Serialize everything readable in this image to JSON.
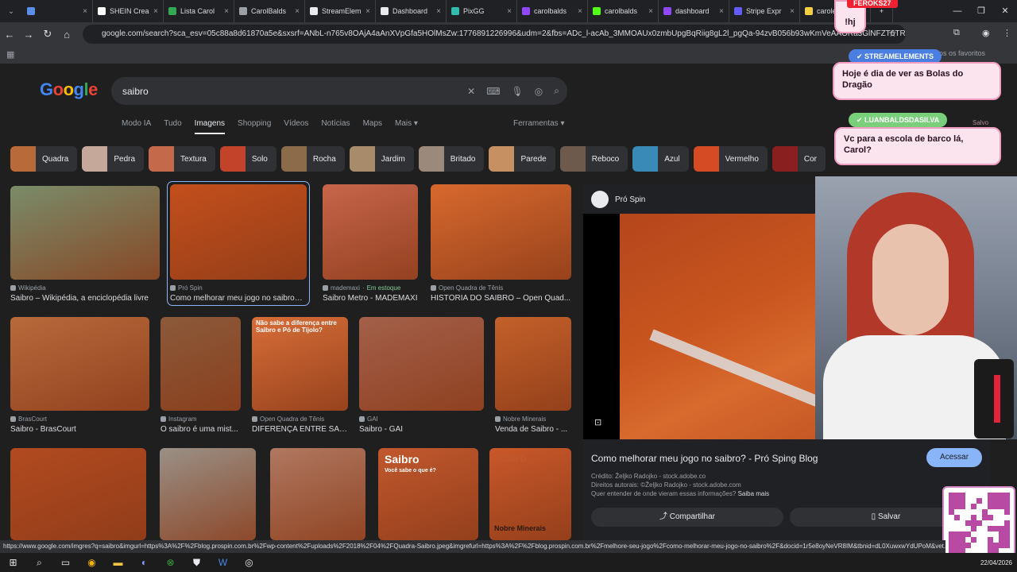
{
  "browser": {
    "tabs": [
      {
        "label": "",
        "color": "#5a8ee8"
      },
      {
        "label": "SHEIN Crea",
        "color": "#ffffff"
      },
      {
        "label": "Lista Carol",
        "color": "#34a853"
      },
      {
        "label": "CarolBalds",
        "color": "#9aa0a6"
      },
      {
        "label": "StreamElem",
        "color": "#e8eaed"
      },
      {
        "label": "Dashboard",
        "color": "#e8eaed"
      },
      {
        "label": "PixGG",
        "color": "#32bcad"
      },
      {
        "label": "carolbalds",
        "color": "#9146ff"
      },
      {
        "label": "carolbalds",
        "color": "#53fc18"
      },
      {
        "label": "dashboard",
        "color": "#9146ff"
      },
      {
        "label": "Stripe Expr",
        "color": "#635bff"
      },
      {
        "label": "carolerhay",
        "color": "#f4d03f"
      }
    ],
    "url": "google.com/search?sca_esv=05c88a8d61870a5e&sxsrf=ANbL-n765v8OAjA4aAnXVpGfa5HOlMsZw:1776891226996&udm=2&fbs=ADc_l-acAb_3MMOAUx0zmbUpgBqRiig8gL2l_pgQa-94zvB056b93wKmVeAAORa3GlNFZT6TR...bnhE...",
    "bookmarks_label": "Todos os favoritos"
  },
  "google": {
    "logo": "Google",
    "query": "saibro",
    "nav": [
      "Modo IA",
      "Tudo",
      "Imagens",
      "Shopping",
      "Vídeos",
      "Notícias",
      "Maps",
      "Mais ▾"
    ],
    "tools": "Ferramentas ▾",
    "chips": [
      {
        "label": "Quadra",
        "color": "#b86a3a"
      },
      {
        "label": "Pedra",
        "color": "#c5a89a"
      },
      {
        "label": "Textura",
        "color": "#c46a4a"
      },
      {
        "label": "Solo",
        "color": "#c2432a"
      },
      {
        "label": "Rocha",
        "color": "#8c6b4a"
      },
      {
        "label": "Jardim",
        "color": "#a88b6a"
      },
      {
        "label": "Britado",
        "color": "#9b8a7c"
      },
      {
        "label": "Parede",
        "color": "#c79062"
      },
      {
        "label": "Reboco",
        "color": "#6d5a4c"
      },
      {
        "label": "Azul",
        "color": "#3a8ab8"
      },
      {
        "label": "Vermelho",
        "color": "#d44b24"
      },
      {
        "label": "Cor",
        "color": "#8a1f1f"
      }
    ],
    "results": [
      {
        "source": "Wikipédia",
        "title": "Saibro – Wikipédia, a enciclopédia livre",
        "color": "#7a8c6a",
        "stock": ""
      },
      {
        "source": "Pró Spin",
        "title": "Como melhorar meu jogo no saibro? ...",
        "color": "#c44f1c",
        "stock": ""
      },
      {
        "source": "mademaxi",
        "title": "Saibro Metro - MADEMAXI",
        "color": "#c7654a",
        "stock": "Em estoque"
      },
      {
        "source": "Open Quadra de Tênis",
        "title": "HISTÓRIA DO SAIBRO – Open Quad...",
        "color": "#d8692e",
        "stock": ""
      },
      {
        "source": "BrasCourt",
        "title": "Saibro - BrasCourt",
        "color": "#b86a3c",
        "stock": ""
      },
      {
        "source": "Instagram",
        "title": "O saibro é uma mist...",
        "color": "#8b5a3a",
        "stock": ""
      },
      {
        "source": "Open Quadra de Tênis",
        "title": "DIFERENÇA ENTRE SAI...",
        "color": "#d86d38",
        "stock": ""
      },
      {
        "source": "GAI",
        "title": "Saibro - GAI",
        "color": "#a4604a",
        "stock": ""
      },
      {
        "source": "Nobre Minerais",
        "title": "Venda de Saibro - ...",
        "color": "#c4602a",
        "stock": ""
      },
      {
        "source": "",
        "title": "",
        "color": "#b24a20",
        "stock": ""
      },
      {
        "source": "",
        "title": "",
        "color": "#9a9086",
        "stock": ""
      },
      {
        "source": "",
        "title": "",
        "color": "#b07860",
        "stock": ""
      },
      {
        "source": "",
        "title": "",
        "color": "#c2582e",
        "stock": ""
      },
      {
        "source": "",
        "title": "",
        "color": "#c9582a",
        "stock": ""
      }
    ],
    "infographic_texts": [
      "Não sabe a diferença entre Saibro e Pó de Tijolo?",
      "Saibro",
      "Você sabe o que é?",
      "Saibro",
      "Nobre Minerais"
    ],
    "preview": {
      "source": "Pró Spin",
      "title": "Como melhorar meu jogo no saibro? - Pró Sping Blog",
      "visit": "Acessar",
      "credit": "Crédito: Željko Radojko - stock.adobe.co",
      "rights": "Direitos autorais: ©Željko Radojko - stock.adobe.com",
      "learn": "Quer entender de onde vieram essas informações?",
      "learn_link": "Saiba mais",
      "share": "Compartilhar",
      "save": "Salvar"
    },
    "status_url": "https://www.google.com/imgres?q=saibro&imgurl=https%3A%2F%2Fblog.prospin.com.br%2Fwp-content%2Fuploads%2F2018%2F04%2FQuadra-Saibro.jpeg&imgrefurl=https%3A%2F%2Fblog.prospin.com.br%2Fmelhore-seu-jogo%2Fcomo-melhorar-meu-jogo-no-saibro%2F&docid=1r5e8oyNeVR8IM&tbnid=dL0XuwxwYdUPoM&vet..."
  },
  "overlay": {
    "top_name": "FEROKS27",
    "top_msg": "!hj",
    "msg1_name": "STREAMELEMENTS",
    "msg1": "Hoje é dia de ver as Bolas do Dragão",
    "msg2_name": "LUANBALDSDASILVA",
    "msg2": "Vc para a escola de barco lá, Carol?",
    "salvo": "Salvo"
  },
  "taskbar": {
    "date": "22/04/2026"
  }
}
